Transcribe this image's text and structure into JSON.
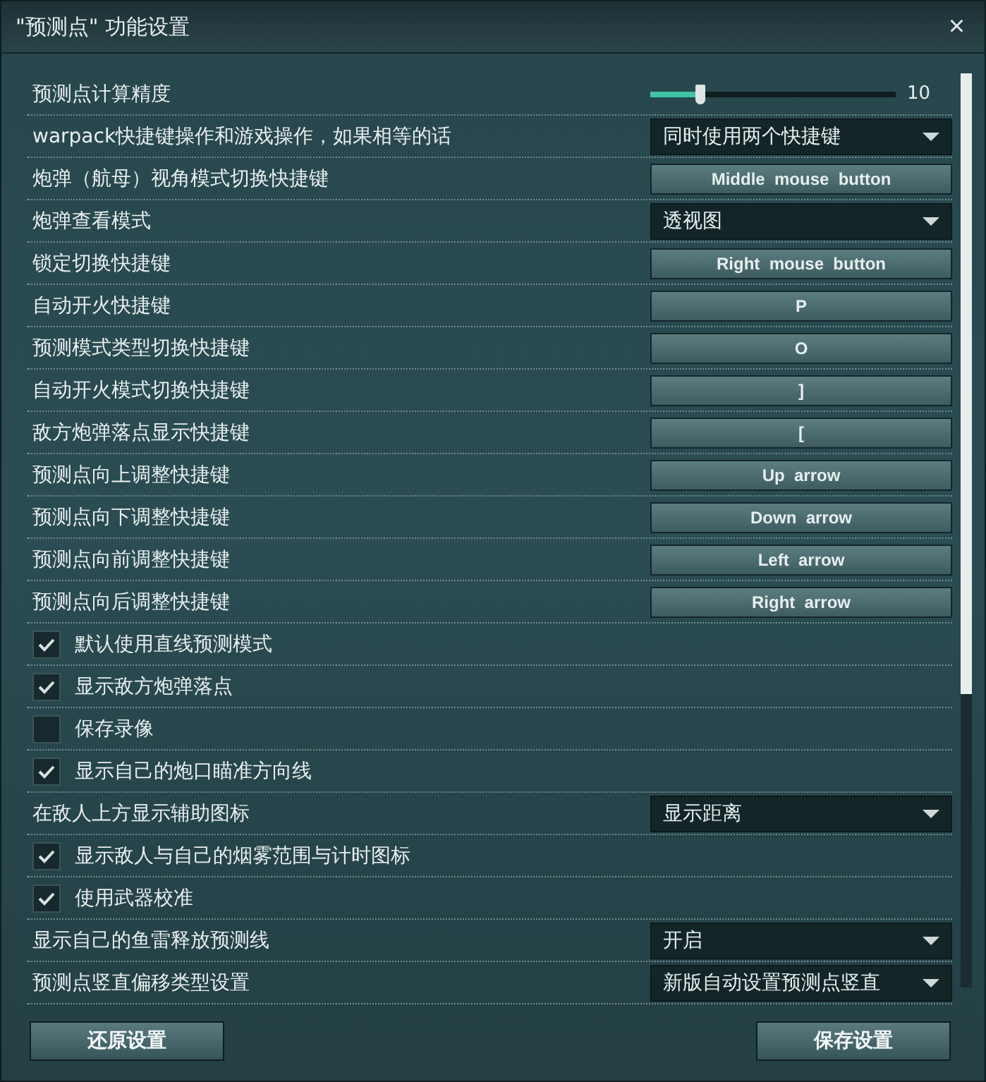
{
  "window": {
    "title": "\"预测点\" 功能设置",
    "close": "×"
  },
  "settings": [
    {
      "kind": "slider",
      "label": "预测点计算精度",
      "level": 0.2,
      "reading": "10"
    },
    {
      "kind": "select",
      "label": "warpack快捷键操作和游戏操作，如果相等的话",
      "value": "同时使用两个快捷键"
    },
    {
      "kind": "key",
      "label": "炮弹（航母）视角模式切换快捷键",
      "value": "Middle  mouse  button"
    },
    {
      "kind": "select",
      "label": "炮弹查看模式",
      "value": "透视图"
    },
    {
      "kind": "key",
      "label": "锁定切换快捷键",
      "value": "Right  mouse  button"
    },
    {
      "kind": "key",
      "label": "自动开火快捷键",
      "value": "P"
    },
    {
      "kind": "key",
      "label": "预测模式类型切换快捷键",
      "value": "O"
    },
    {
      "kind": "key",
      "label": "自动开火模式切换快捷键",
      "value": "]"
    },
    {
      "kind": "key",
      "label": "敌方炮弹落点显示快捷键",
      "value": "["
    },
    {
      "kind": "key",
      "label": "预测点向上调整快捷键",
      "value": "Up  arrow"
    },
    {
      "kind": "key",
      "label": "预测点向下调整快捷键",
      "value": "Down  arrow"
    },
    {
      "kind": "key",
      "label": "预测点向前调整快捷键",
      "value": "Left  arrow"
    },
    {
      "kind": "key",
      "label": "预测点向后调整快捷键",
      "value": "Right  arrow"
    },
    {
      "kind": "check",
      "label": "默认使用直线预测模式",
      "checked": true
    },
    {
      "kind": "check",
      "label": "显示敌方炮弹落点",
      "checked": true
    },
    {
      "kind": "check",
      "label": "保存录像",
      "checked": false
    },
    {
      "kind": "check",
      "label": "显示自己的炮口瞄准方向线",
      "checked": true
    },
    {
      "kind": "select",
      "label": "在敌人上方显示辅助图标",
      "value": "显示距离"
    },
    {
      "kind": "check",
      "label": "显示敌人与自己的烟雾范围与计时图标",
      "checked": true
    },
    {
      "kind": "check",
      "label": "使用武器校准",
      "checked": true
    },
    {
      "kind": "select",
      "label": "显示自己的鱼雷释放预测线",
      "value": "开启"
    },
    {
      "kind": "select",
      "label": "预测点竖直偏移类型设置",
      "value": "新版自动设置预测点竖直"
    }
  ],
  "buttons": {
    "reset": "还原设置",
    "save": "保存设置"
  }
}
